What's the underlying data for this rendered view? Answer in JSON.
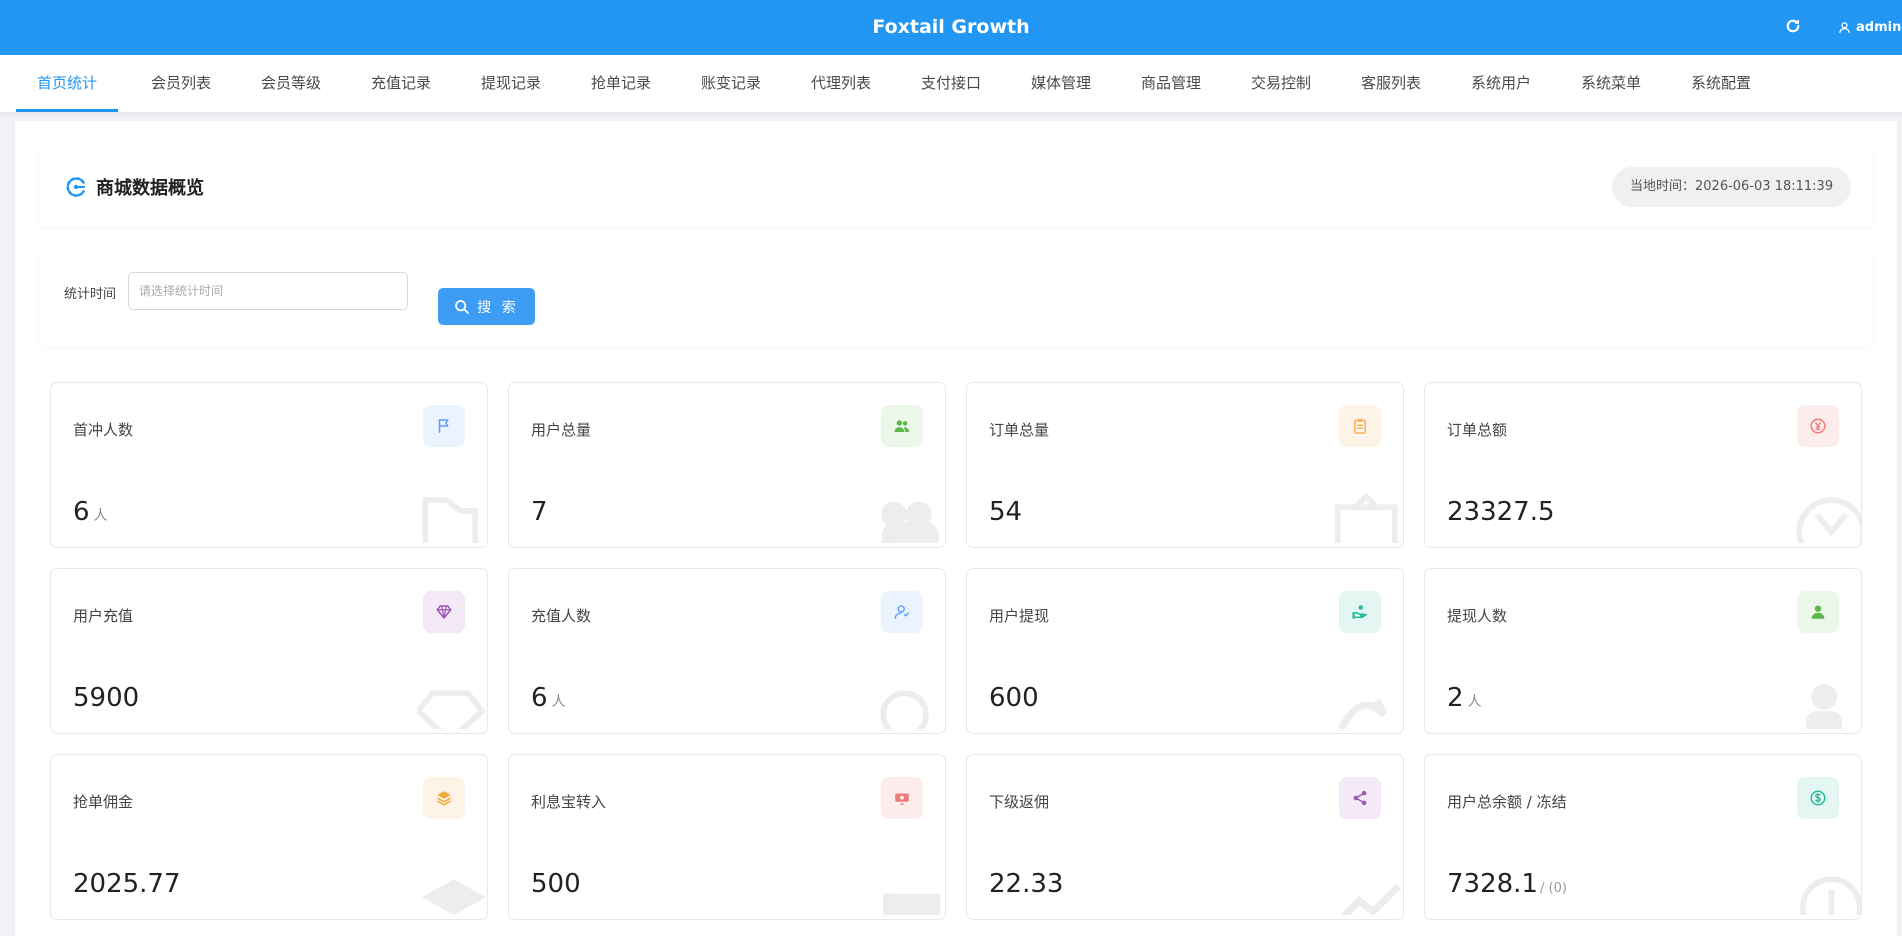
{
  "header": {
    "app_title": "Foxtail Growth",
    "user_name": "admin"
  },
  "nav": {
    "items": [
      "首页统计",
      "会员列表",
      "会员等级",
      "充值记录",
      "提现记录",
      "抢单记录",
      "账变记录",
      "代理列表",
      "支付接口",
      "媒体管理",
      "商品管理",
      "交易控制",
      "客服列表",
      "系统用户",
      "系统菜单",
      "系统配置"
    ],
    "active_index": 0
  },
  "overview": {
    "title": "商城数据概览",
    "time_label": "当地时间：",
    "time_value": "2026-06-03 18:11:39"
  },
  "filter": {
    "label": "统计时间",
    "placeholder": "请选择统计时间",
    "value": "",
    "search_label": "搜 索"
  },
  "cards": [
    {
      "title": "首冲人数",
      "value": "6",
      "unit": "人",
      "icon": "flag-icon",
      "icon_color": "#5b9cf5",
      "icon_bg": "#eaf3fe"
    },
    {
      "title": "用户总量",
      "value": "7",
      "unit": "",
      "icon": "users-icon",
      "icon_color": "#5bb84a",
      "icon_bg": "#ebf7e8"
    },
    {
      "title": "订单总量",
      "value": "54",
      "unit": "",
      "icon": "clipboard-icon",
      "icon_color": "#f3b257",
      "icon_bg": "#fdf3e6"
    },
    {
      "title": "订单总额",
      "value": "23327.5",
      "unit": "",
      "icon": "yen-icon",
      "icon_color": "#f07a7a",
      "icon_bg": "#fdecec"
    },
    {
      "title": "用户充值",
      "value": "5900",
      "unit": "",
      "icon": "diamond-icon",
      "icon_color": "#9b59b6",
      "icon_bg": "#f3e9f7"
    },
    {
      "title": "充值人数",
      "value": "6",
      "unit": "人",
      "icon": "user-outline-icon",
      "icon_color": "#5b9cf5",
      "icon_bg": "#eaf3fe"
    },
    {
      "title": "用户提现",
      "value": "600",
      "unit": "",
      "icon": "hand-coin-icon",
      "icon_color": "#2bb89b",
      "icon_bg": "#e3f6f1"
    },
    {
      "title": "提现人数",
      "value": "2",
      "unit": "人",
      "icon": "user-icon",
      "icon_color": "#5bb84a",
      "icon_bg": "#ebf7e8"
    },
    {
      "title": "抢单佣金",
      "value": "2025.77",
      "unit": "",
      "icon": "layers-icon",
      "icon_color": "#f3a93b",
      "icon_bg": "#fdf3e6"
    },
    {
      "title": "利息宝转入",
      "value": "500",
      "unit": "",
      "icon": "money-icon",
      "icon_color": "#f07a7a",
      "icon_bg": "#fdecec"
    },
    {
      "title": "下级返佣",
      "value": "22.33",
      "unit": "",
      "icon": "share-icon",
      "icon_color": "#9b59b6",
      "icon_bg": "#f3e9f7"
    },
    {
      "title": "用户总余额 / 冻结",
      "value": "7328.1",
      "unit": "",
      "sub": "/ (0)",
      "icon": "dollar-circle-icon",
      "icon_color": "#2bb89b",
      "icon_bg": "#e3f6f1"
    }
  ]
}
